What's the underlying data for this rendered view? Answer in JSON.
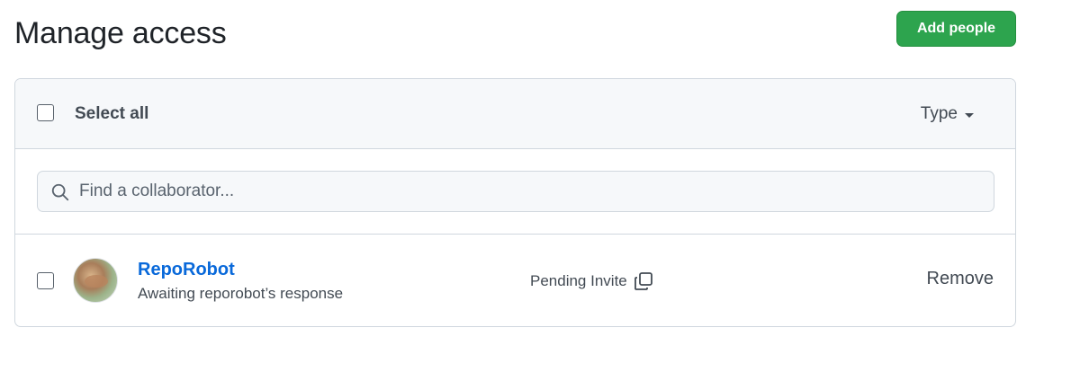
{
  "header": {
    "title": "Manage access",
    "add_people_label": "Add people"
  },
  "list_header": {
    "select_all_label": "Select all",
    "type_filter_label": "Type"
  },
  "search": {
    "placeholder": "Find a collaborator..."
  },
  "members": [
    {
      "name": "RepoRobot",
      "subtitle": "Awaiting reporobot’s response",
      "status": "Pending Invite",
      "remove_label": "Remove"
    }
  ],
  "colors": {
    "primary_button": "#2da44e",
    "link": "#0969da",
    "border": "#d0d7de",
    "header_bg": "#f6f8fa"
  }
}
